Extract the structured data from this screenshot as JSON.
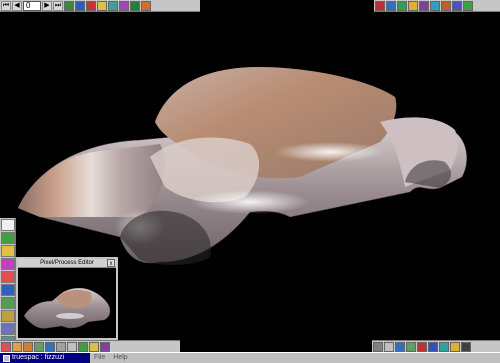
{
  "toolbar_top": {
    "frame_value": "0",
    "transport": [
      "⏮",
      "◀",
      "▶",
      "⏭"
    ],
    "colors": [
      "#3a8a3a",
      "#2b5dbd",
      "#c83232",
      "#e0c040",
      "#40a0a0",
      "#9a4ab0",
      "#208040",
      "#d07030"
    ]
  },
  "toolbar_right": {
    "colors": [
      "#c03030",
      "#3070c0",
      "#30a050",
      "#e0b030",
      "#8040a0",
      "#30a0c0",
      "#c06030",
      "#5050c0",
      "#40a040"
    ]
  },
  "left_tools": {
    "colors": [
      "#f0f0f0",
      "#40a040",
      "#e0c040",
      "#c040c0",
      "#e05050",
      "#3060c0",
      "#50a050",
      "#c0a040",
      "#7070c0",
      "#40a0a0"
    ]
  },
  "editor": {
    "title": "Pixel/Process Editor",
    "close": "x"
  },
  "taskbar": {
    "task_label": "truespac : fizzuzi",
    "menus": [
      "File",
      "Help"
    ]
  },
  "bottom_left": {
    "colors": [
      "#e05050",
      "#e0a040",
      "#d08030",
      "#60a060",
      "#3070c0",
      "#a0a0a0",
      "#c0c0c0",
      "#40a040",
      "#e0c040",
      "#8040a0"
    ]
  },
  "bottom_right": {
    "colors": [
      "#808080",
      "#c0c0c0",
      "#3070c0",
      "#60a060",
      "#c03030",
      "#3050c0",
      "#30a0a0",
      "#e0b030",
      "#404040"
    ]
  }
}
